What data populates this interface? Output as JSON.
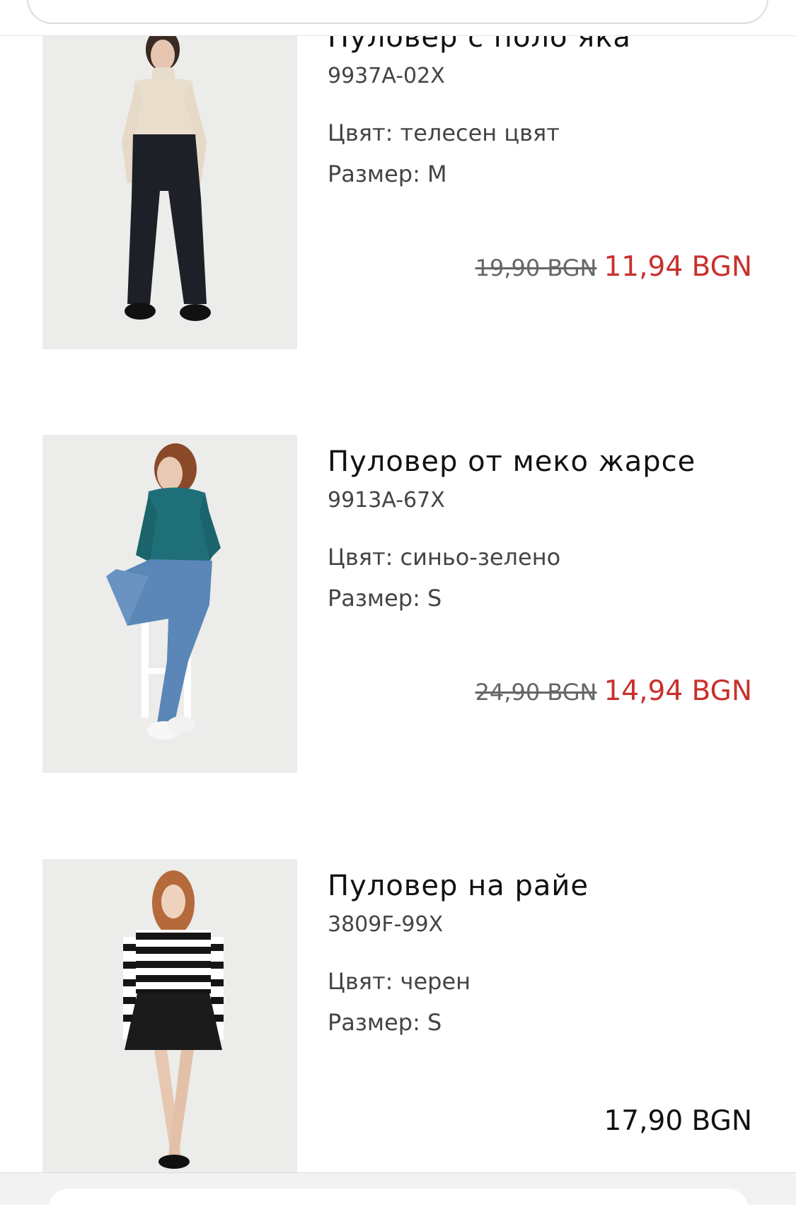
{
  "products": [
    {
      "title": "Пуловер с поло яка",
      "code": "9937A-02X",
      "color_label": "Цвят: телесен цвят",
      "size_label": "Размер: M",
      "old_price": "19,90 BGN",
      "price": "11,94 BGN"
    },
    {
      "title": "Пуловер от меко жарсе",
      "code": "9913A-67X",
      "color_label": "Цвят: синьо-зелено",
      "size_label": "Размер: S",
      "old_price": "24,90 BGN",
      "price": "14,94 BGN"
    },
    {
      "title": "Пуловер на райе",
      "code": "3809F-99X",
      "color_label": "Цвят: черен",
      "size_label": "Размер: S",
      "price": "17,90 BGN"
    }
  ],
  "colors": {
    "sale_price": "#c9302c",
    "text": "#111111",
    "muted": "#444444",
    "image_bg": "#ededed"
  },
  "icons": [
    "product-photo-turtleneck",
    "product-photo-teal-sweater",
    "product-photo-striped-sweater"
  ]
}
